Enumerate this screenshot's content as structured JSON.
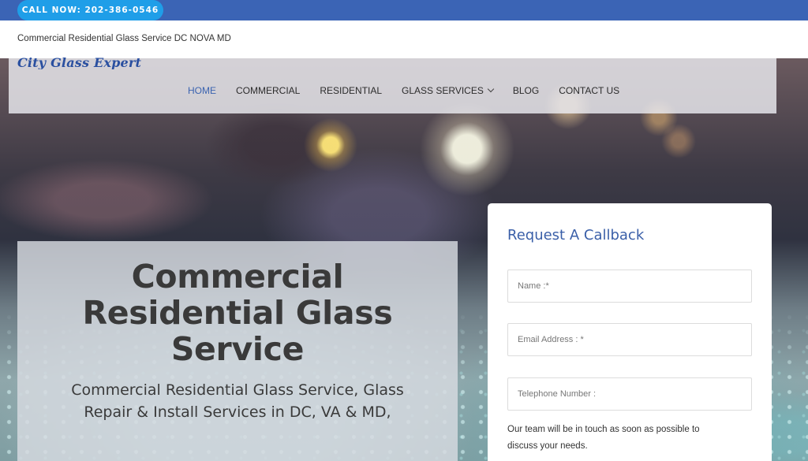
{
  "topbar": {
    "call_label": "CALL NOW: 202-386-0546"
  },
  "tagline": "Commercial Residential Glass Service DC NOVA MD",
  "logo": "City Glass Expert",
  "nav": {
    "items": [
      {
        "label": "HOME",
        "active": true
      },
      {
        "label": "COMMERCIAL"
      },
      {
        "label": "RESIDENTIAL"
      },
      {
        "label": "GLASS SERVICES",
        "dropdown": true
      },
      {
        "label": "BLOG"
      },
      {
        "label": "CONTACT US"
      }
    ]
  },
  "hero": {
    "title_lines": [
      "Commercial",
      "Residential Glass",
      "Service"
    ],
    "subtitle_lines": [
      "Commercial Residential Glass Service, Glass",
      "Repair & Install Services in DC, VA & MD,"
    ]
  },
  "form": {
    "title": "Request A Callback",
    "name_placeholder": "Name :*",
    "email_placeholder": "Email Address : *",
    "phone_placeholder": "Telephone Number :",
    "note_lines": [
      "Our team will be in touch as soon as possible to",
      "discuss your needs."
    ]
  },
  "colors": {
    "topbar": "#3b64b5",
    "call_button": "#1f9ee8",
    "accent": "#3a63b0"
  }
}
